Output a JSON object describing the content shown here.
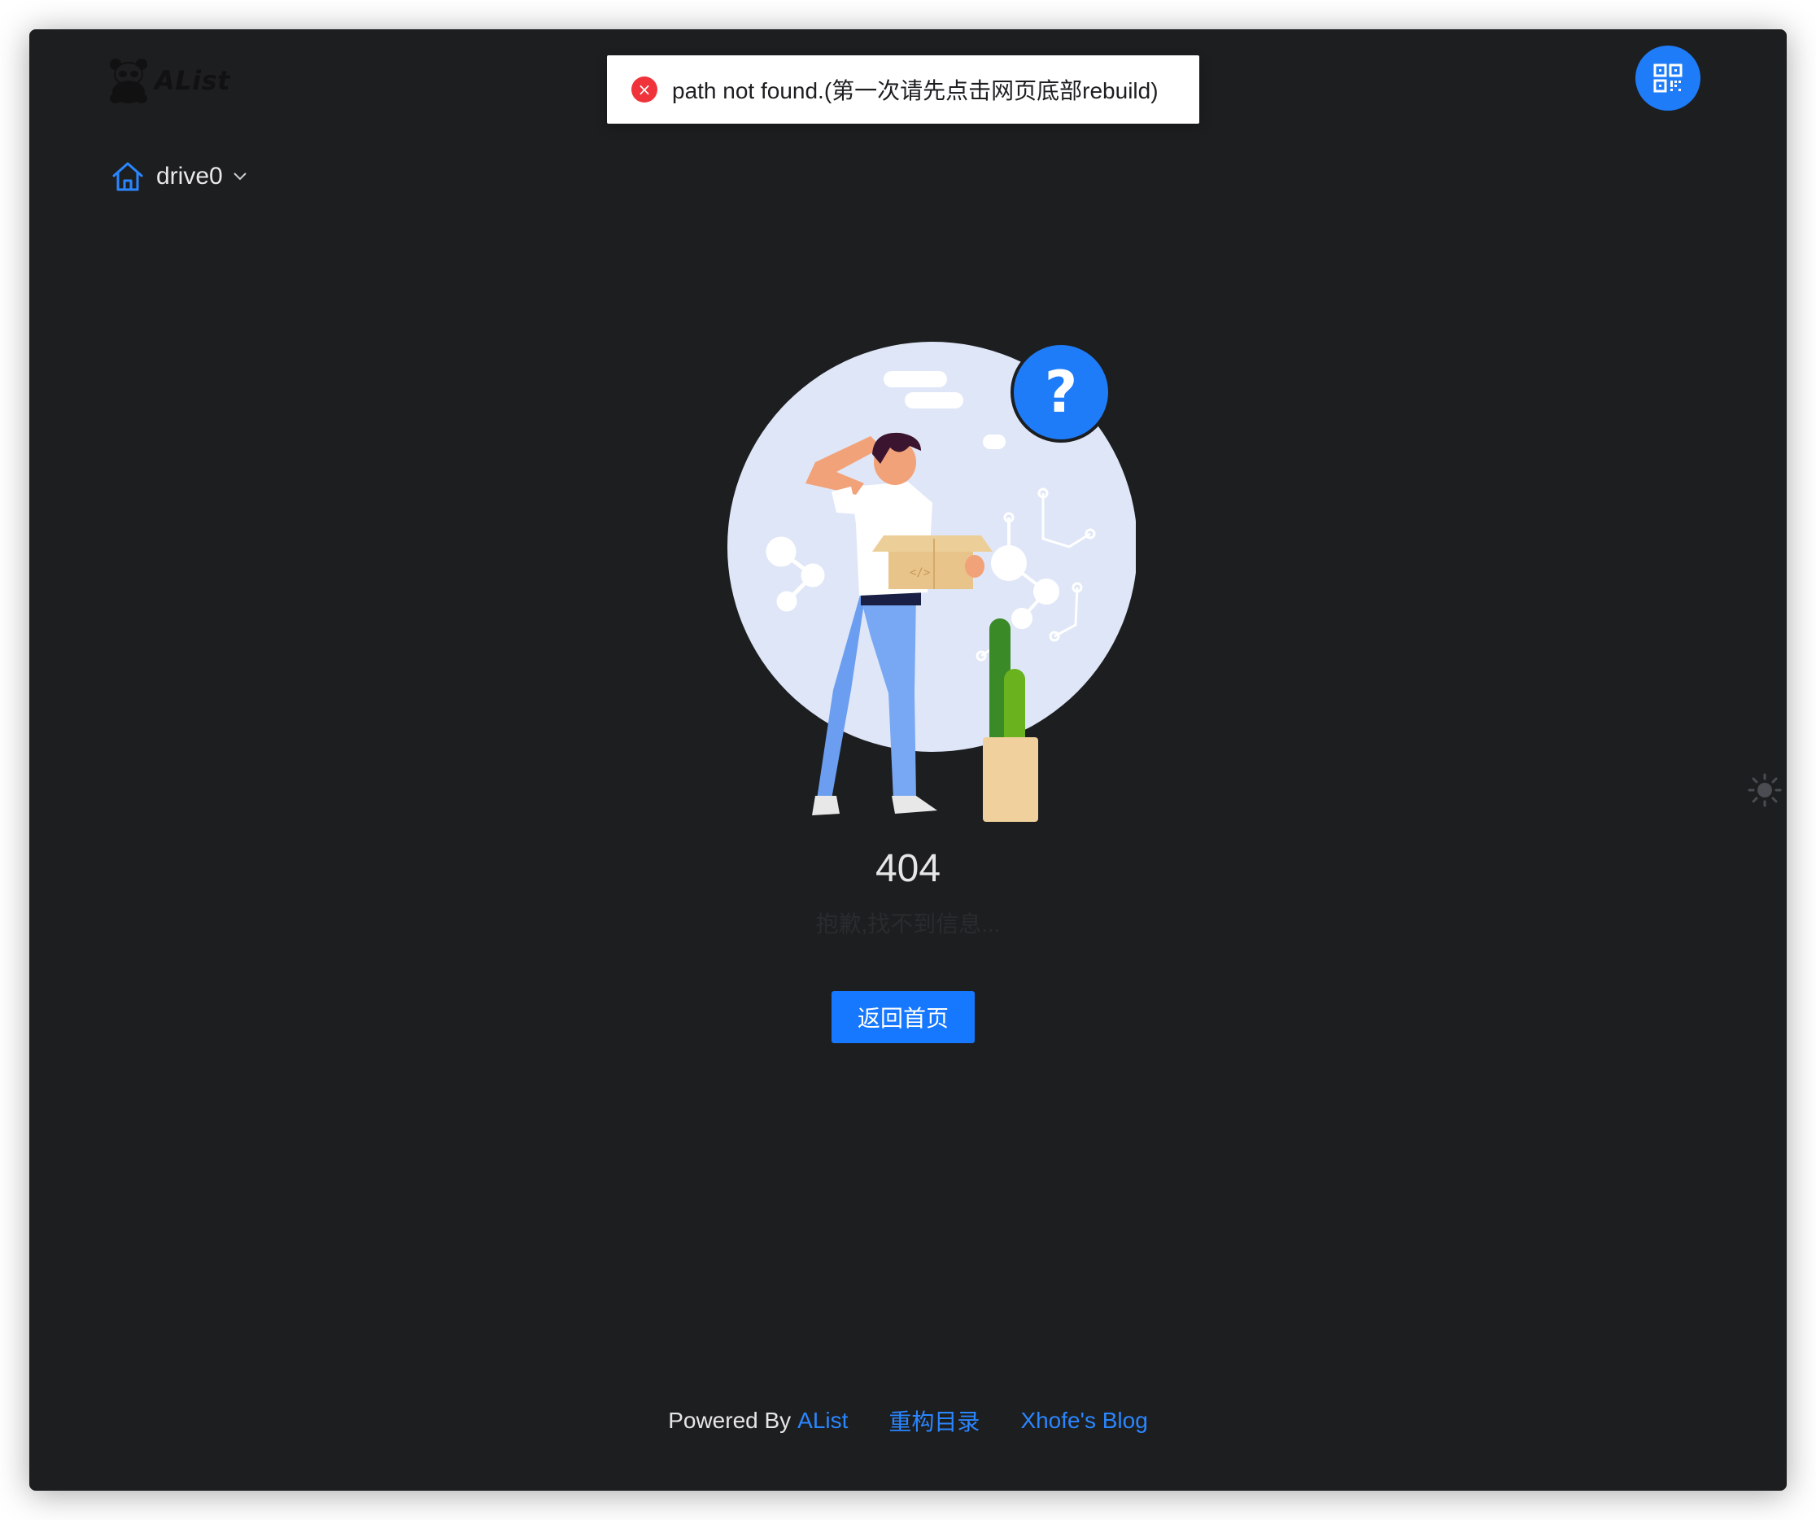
{
  "header": {
    "logo_text": "AList"
  },
  "toast": {
    "message": "path not found.(第一次请先点击网页底部rebuild)",
    "icon": "close-circle-icon",
    "icon_glyph": "×",
    "icon_color": "#f0333b"
  },
  "qr_button": {
    "icon": "qrcode-icon",
    "color": "#1e7cf9"
  },
  "breadcrumb": {
    "icon": "home-icon",
    "label": "drive0"
  },
  "error": {
    "code": "404",
    "message": "抱歉,找不到信息...",
    "button_label": "返回首页"
  },
  "theme": {
    "icon": "sun-icon"
  },
  "footer": {
    "powered_by": "Powered By",
    "alist_link": "AList",
    "rebuild_link": "重构目录",
    "blog_link": "Xhofe's Blog"
  },
  "colors": {
    "background": "#1d1e20",
    "accent": "#1677ff",
    "link": "#2a86ff"
  }
}
